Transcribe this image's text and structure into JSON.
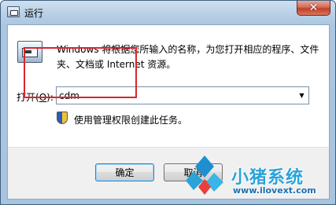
{
  "window": {
    "title": "运行",
    "close_glyph": "✕"
  },
  "dialog": {
    "description": "Windows 将根据您所输入的名称，为您打开相应的程序、文件夹、文档或 Internet 资源。",
    "open_label_prefix": "打开(",
    "open_label_key": "O",
    "open_label_suffix": "):",
    "open_value": "cdm",
    "dropdown_glyph": "▼",
    "admin_note": "使用管理权限创建此任务。"
  },
  "buttons": {
    "ok": "确定",
    "cancel": "取消"
  },
  "watermark": {
    "title": "小猪系统",
    "url": "www.ilovext.com"
  },
  "colors": {
    "highlight": "#d9252c",
    "accent": "#2aa3d8"
  }
}
